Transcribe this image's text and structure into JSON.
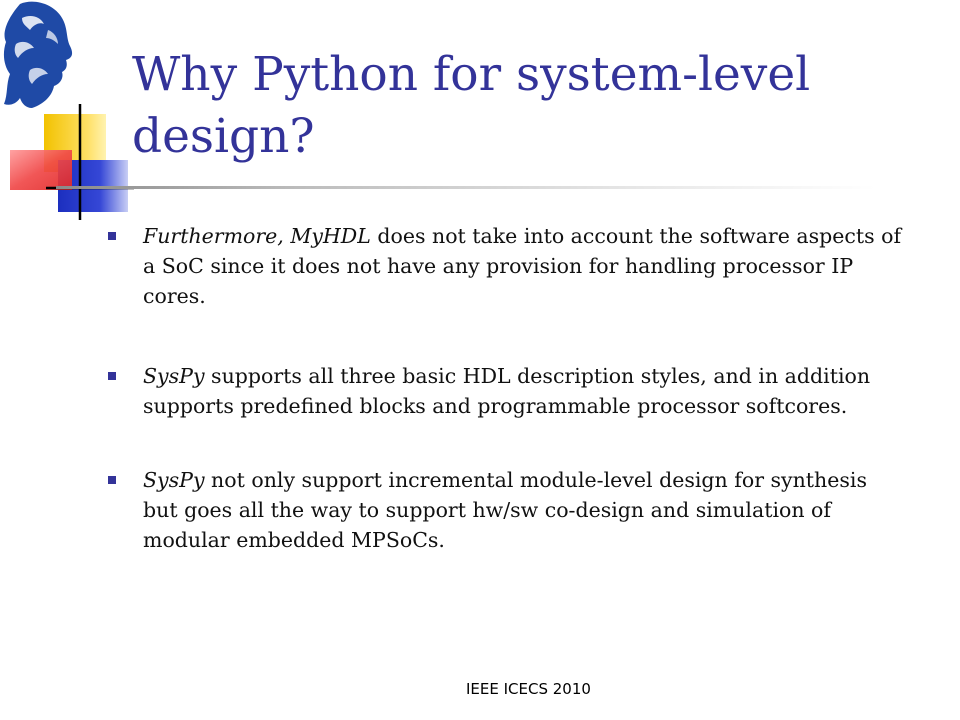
{
  "slide": {
    "title": "Why Python for system-level design?",
    "bullets": [
      {
        "lead_em": "Furthermore, MyHDL",
        "text": " does not take into account the software aspects of a SoC since it does not have any provision for handling processor IP cores."
      },
      {
        "lead_em": "SysPy",
        "text": " supports all three basic HDL description styles, and in addition supports predefined blocks and programmable processor softcores."
      },
      {
        "lead_em": "SysPy",
        "text": " not only support incremental module-level design for synthesis  but goes all the way to support hw/sw co-design and simulation of modular embedded MPSoCs."
      }
    ],
    "footer": "IEEE ICECS 2010"
  },
  "colors": {
    "title": "#333399",
    "bullet": "#333399",
    "deco_yellow": "#f5d000",
    "deco_blue": "#2b3bc8",
    "deco_red": "#ee3a3a"
  },
  "icons": {
    "logo": "university-crest-head-icon",
    "bullet": "square-bullet-icon"
  }
}
